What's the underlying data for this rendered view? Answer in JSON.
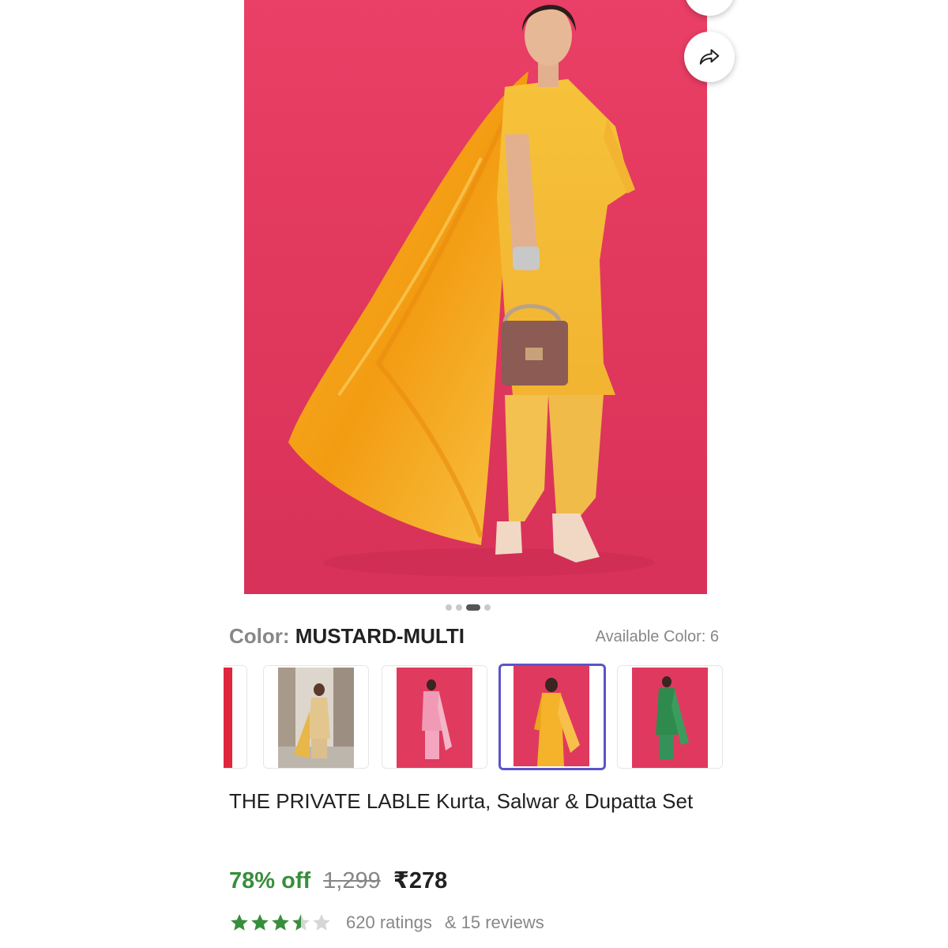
{
  "product": {
    "title": "THE PRIVATE LABLE Kurta, Salwar & Dupatta Set",
    "color_label": "Color:",
    "color_value": "MUSTARD-MULTI",
    "available_colors": "Available Color: 6",
    "image_carousel": {
      "total_images": 4,
      "active_index": 2
    },
    "swatches": [
      {
        "name": "red-partial",
        "selected": false
      },
      {
        "name": "beige",
        "selected": false
      },
      {
        "name": "pink",
        "selected": false
      },
      {
        "name": "mustard",
        "selected": true
      },
      {
        "name": "green",
        "selected": false
      }
    ]
  },
  "pricing": {
    "discount": "78% off",
    "mrp": "1,299",
    "price": "₹278"
  },
  "rating": {
    "stars": 3.5,
    "ratings_text": "620 ratings",
    "reviews_text": "& 15 reviews",
    "star_color": "#388e3c"
  },
  "icons": {
    "share": "share-icon",
    "wishlist": "heart-icon"
  },
  "colors": {
    "hero_bg": "#e43b61",
    "discount_green": "#388e3c",
    "selected_border": "#5a55c8",
    "mustard": "#f4b32b"
  }
}
